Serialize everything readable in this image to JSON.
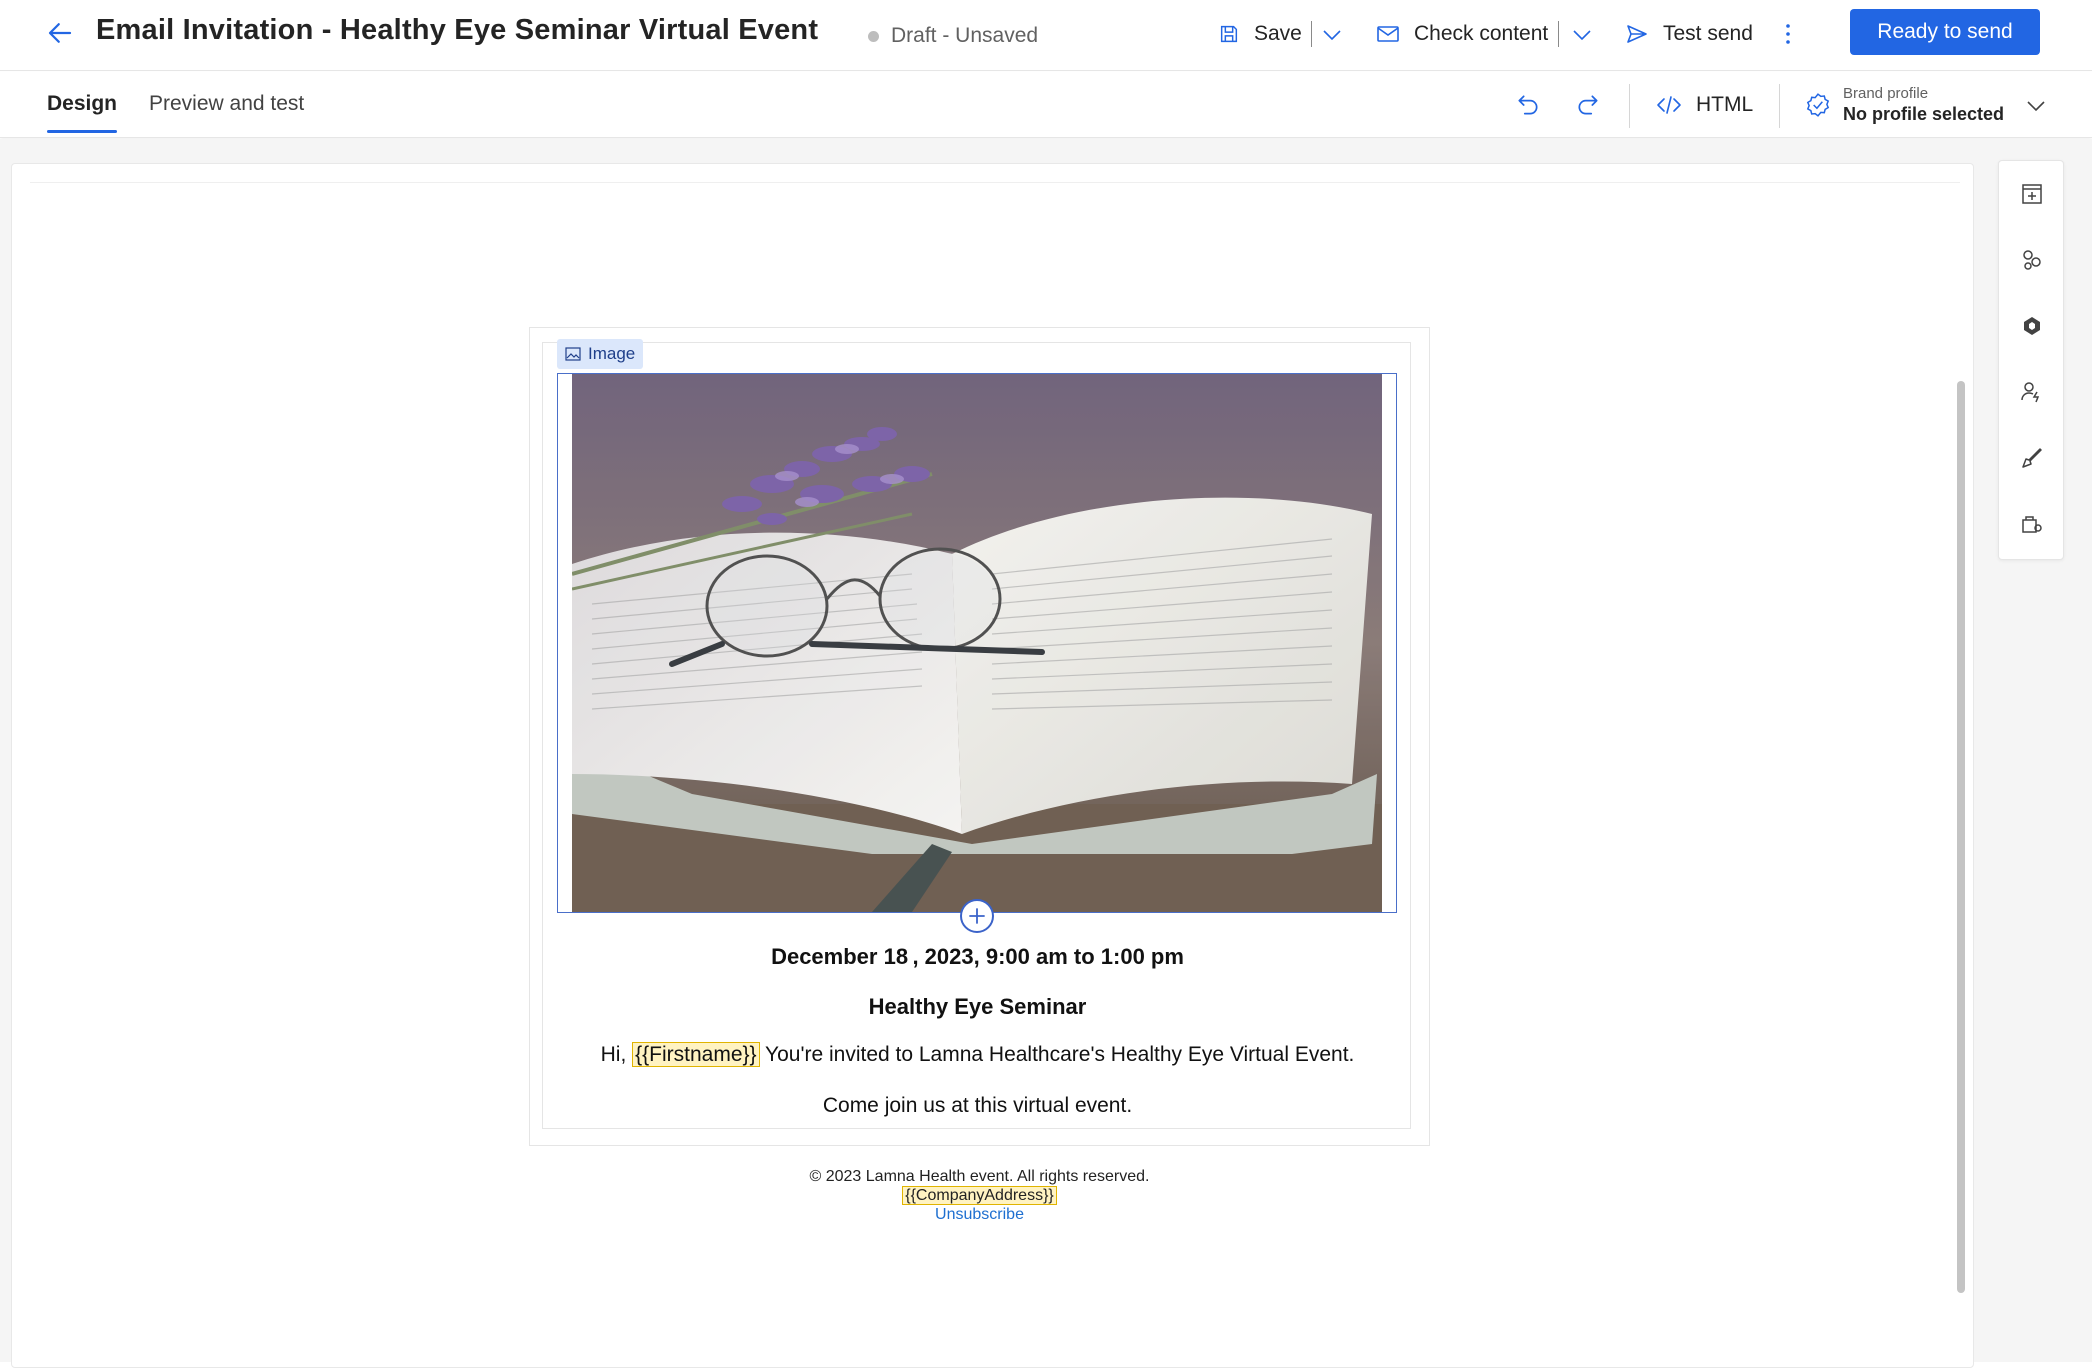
{
  "header": {
    "title": "Email Invitation - Healthy Eye Seminar Virtual Event",
    "status": "Draft - Unsaved",
    "save_label": "Save",
    "check_content_label": "Check content",
    "test_send_label": "Test send",
    "primary_label": "Ready to send"
  },
  "tabs": {
    "design": "Design",
    "preview": "Preview and test"
  },
  "editor_toolbar": {
    "html_label": "HTML",
    "brand_profile_label": "Brand profile",
    "brand_profile_value": "No profile selected"
  },
  "email": {
    "image_tag": "Image",
    "date_line": "December 18 , 2023, 9:00 am to 1:00 pm",
    "headline": "Healthy Eye Seminar",
    "greeting_prefix": "Hi,",
    "firstname_token": "{{Firstname}}",
    "greeting_suffix": "You're invited to Lamna Healthcare's Healthy Eye Virtual Event.",
    "cta": "Come join us at this virtual event.",
    "footer_copyright": "© 2023 Lamna Health event. All rights reserved.",
    "footer_address_token": "{{CompanyAddress}}",
    "footer_unsubscribe": "Unsubscribe"
  },
  "toolbox_icons": [
    "add-element-icon",
    "elements-icon",
    "copilot-icon",
    "personalization-icon",
    "styles-icon",
    "assets-icon"
  ],
  "colors": {
    "accent": "#2266e3",
    "token_bg": "#fff3c2",
    "link": "#1e6fd0"
  }
}
